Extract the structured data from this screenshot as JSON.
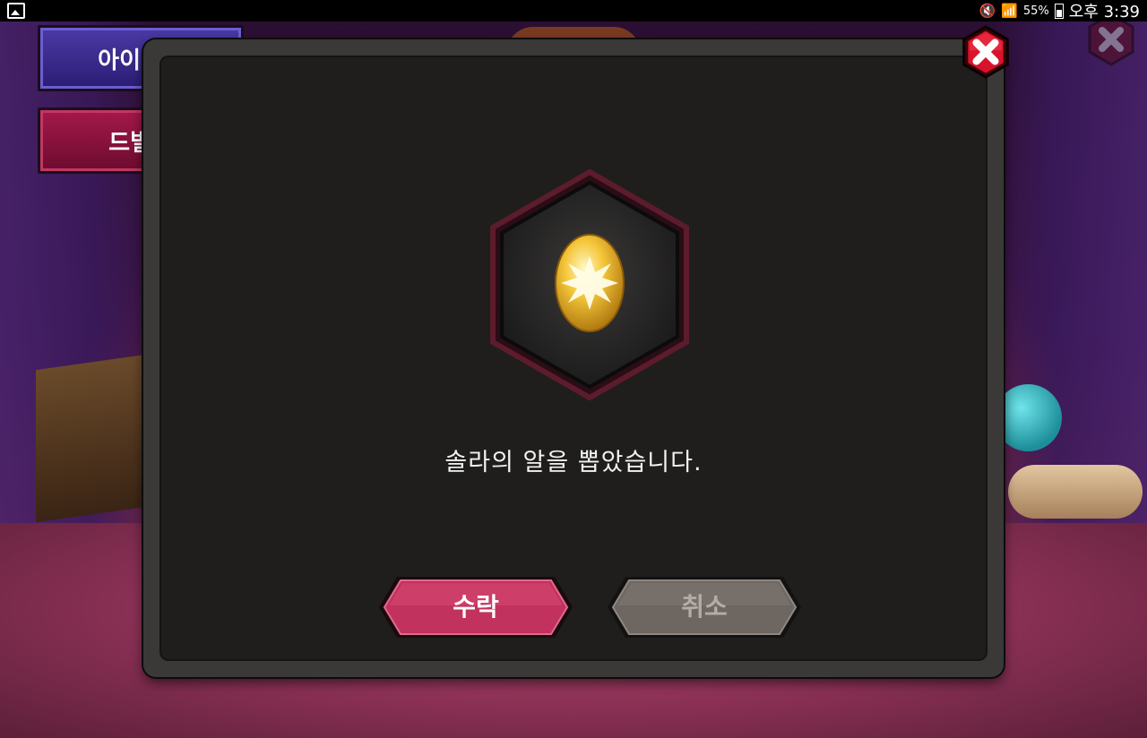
{
  "status_bar": {
    "battery": "55%",
    "time": "오후 3:39"
  },
  "background": {
    "item_code_button": "아이템코",
    "drill_button": "드빌가"
  },
  "dialog": {
    "message": "솔라의 알을 뽑았습니다.",
    "accept_label": "수락",
    "cancel_label": "취소",
    "item_icon": "golden-egg-icon"
  },
  "colors": {
    "accept": "#c2325e",
    "cancel": "#7a716b",
    "close": "#d9132b"
  }
}
